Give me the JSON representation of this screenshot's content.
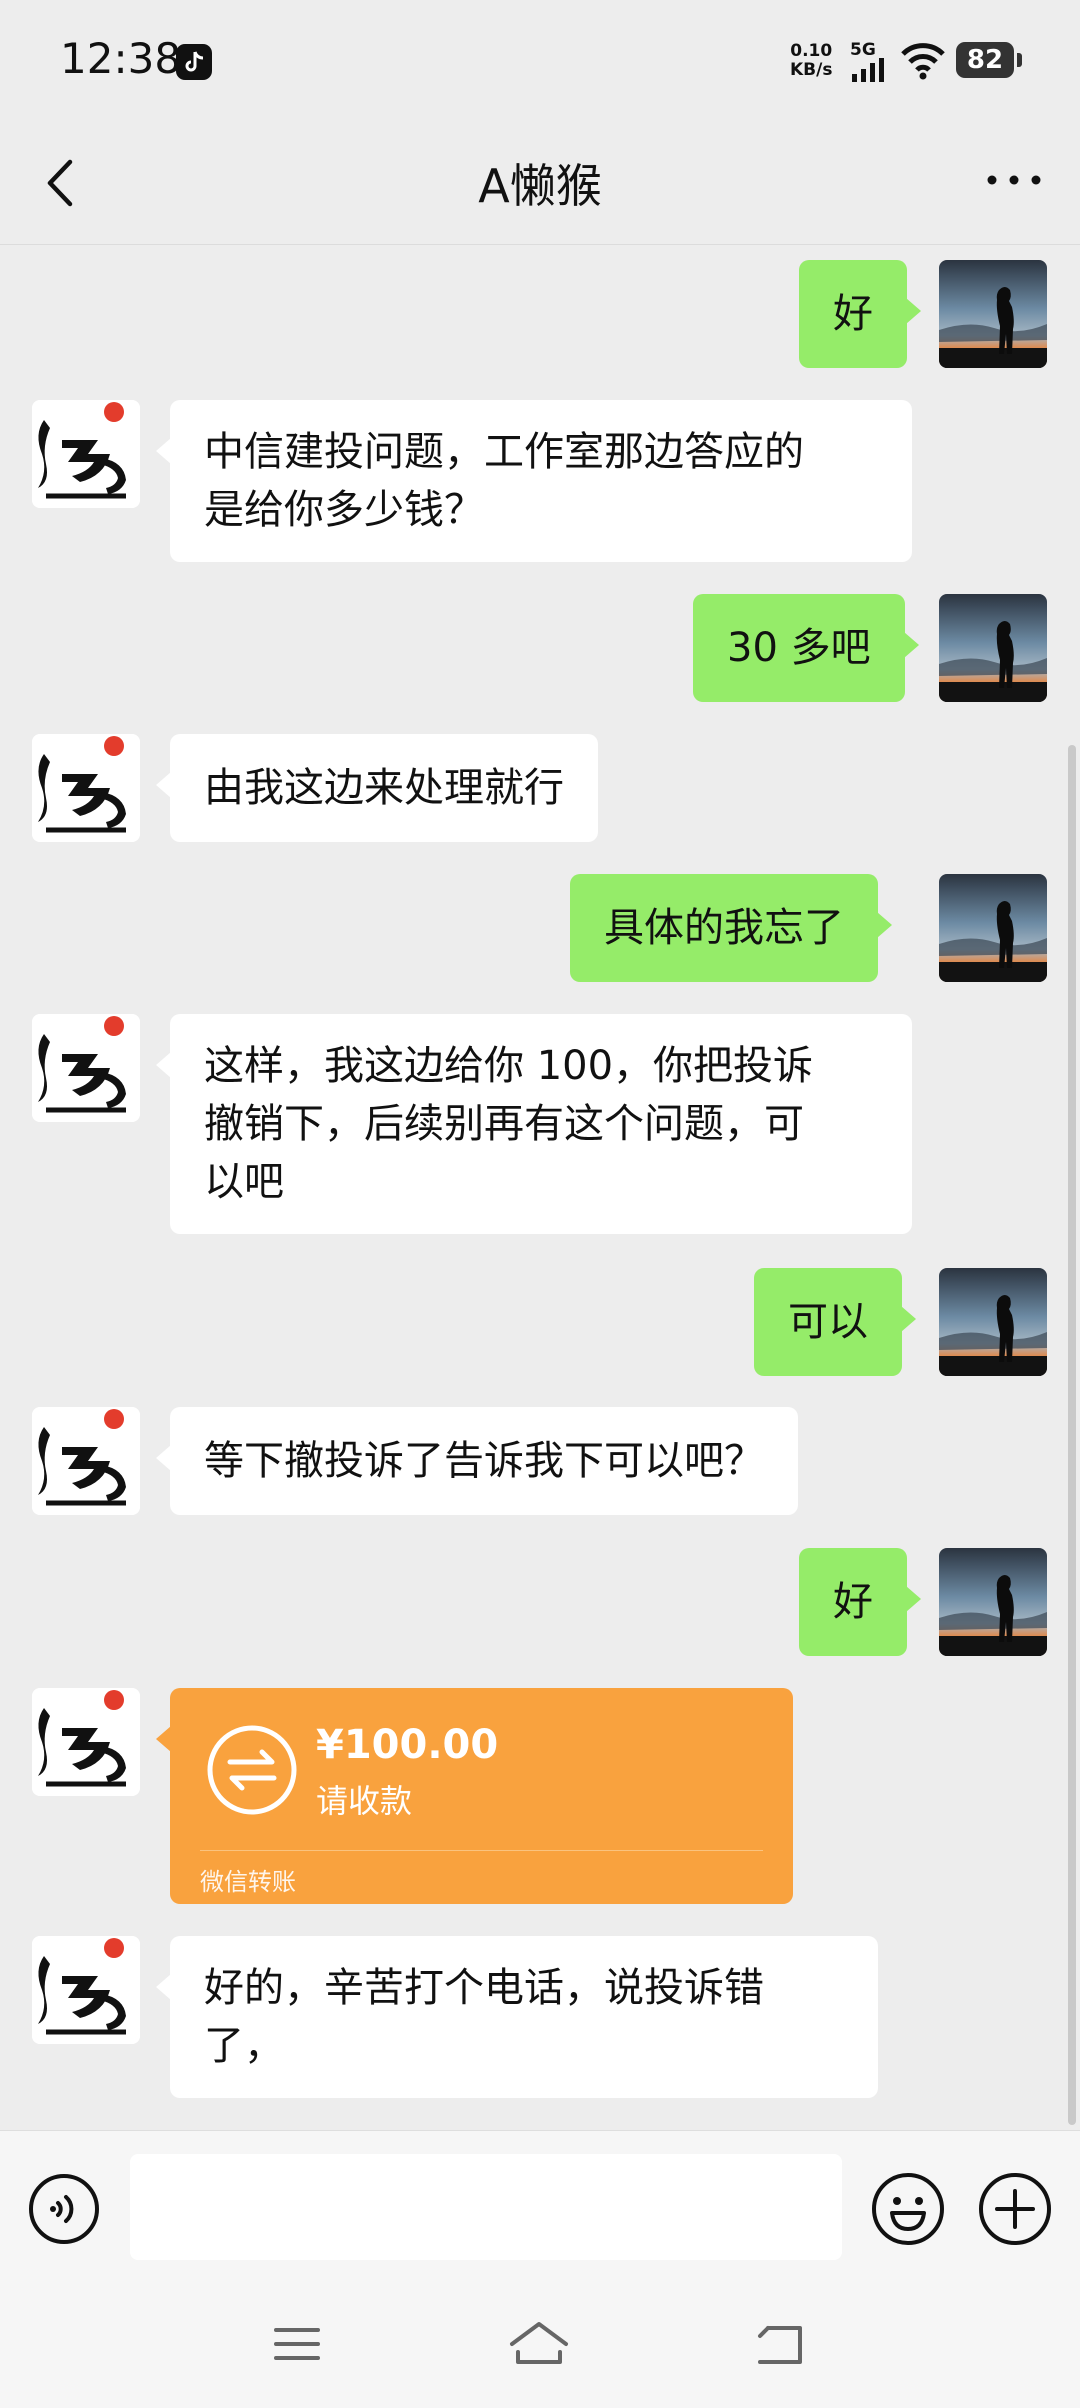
{
  "status_bar": {
    "time": "12:38",
    "net_speed_value": "0.10",
    "net_speed_unit": "KB/s",
    "network": "5G",
    "battery": "82"
  },
  "header": {
    "title": "A懒猴"
  },
  "messages": [
    {
      "from": "me",
      "text": "好"
    },
    {
      "from": "other",
      "lines": [
        "中信建投问题，工作室那边答应的",
        "是给你多少钱？"
      ]
    },
    {
      "from": "me",
      "text": "30 多吧"
    },
    {
      "from": "other",
      "text": "由我这边来处理就行"
    },
    {
      "from": "me",
      "text": "具体的我忘了"
    },
    {
      "from": "other",
      "lines": [
        "这样，我这边给你 100，你把投诉",
        "撤销下，后续别再有这个问题，可",
        "以吧"
      ]
    },
    {
      "from": "me",
      "text": "可以"
    },
    {
      "from": "other",
      "text": "等下撤投诉了告诉我下可以吧？"
    },
    {
      "from": "me",
      "text": "好"
    },
    {
      "from": "other",
      "type": "transfer",
      "amount": "¥100.00",
      "status": "请收款",
      "footer": "微信转账"
    },
    {
      "from": "other",
      "lines": [
        "好的，辛苦打个电话，说投诉错",
        "了，"
      ]
    }
  ],
  "input_bar": {
    "placeholder": ""
  },
  "colors": {
    "my_bubble": "#95ec69",
    "other_bubble": "#ffffff",
    "transfer_card": "#f9a23e",
    "background": "#ededed"
  },
  "icons": {
    "back": "chevron-left-icon",
    "more": "more-dots-icon",
    "voice": "voice-icon",
    "emoji": "emoji-icon",
    "plus": "plus-icon",
    "transfer": "transfer-icon"
  }
}
